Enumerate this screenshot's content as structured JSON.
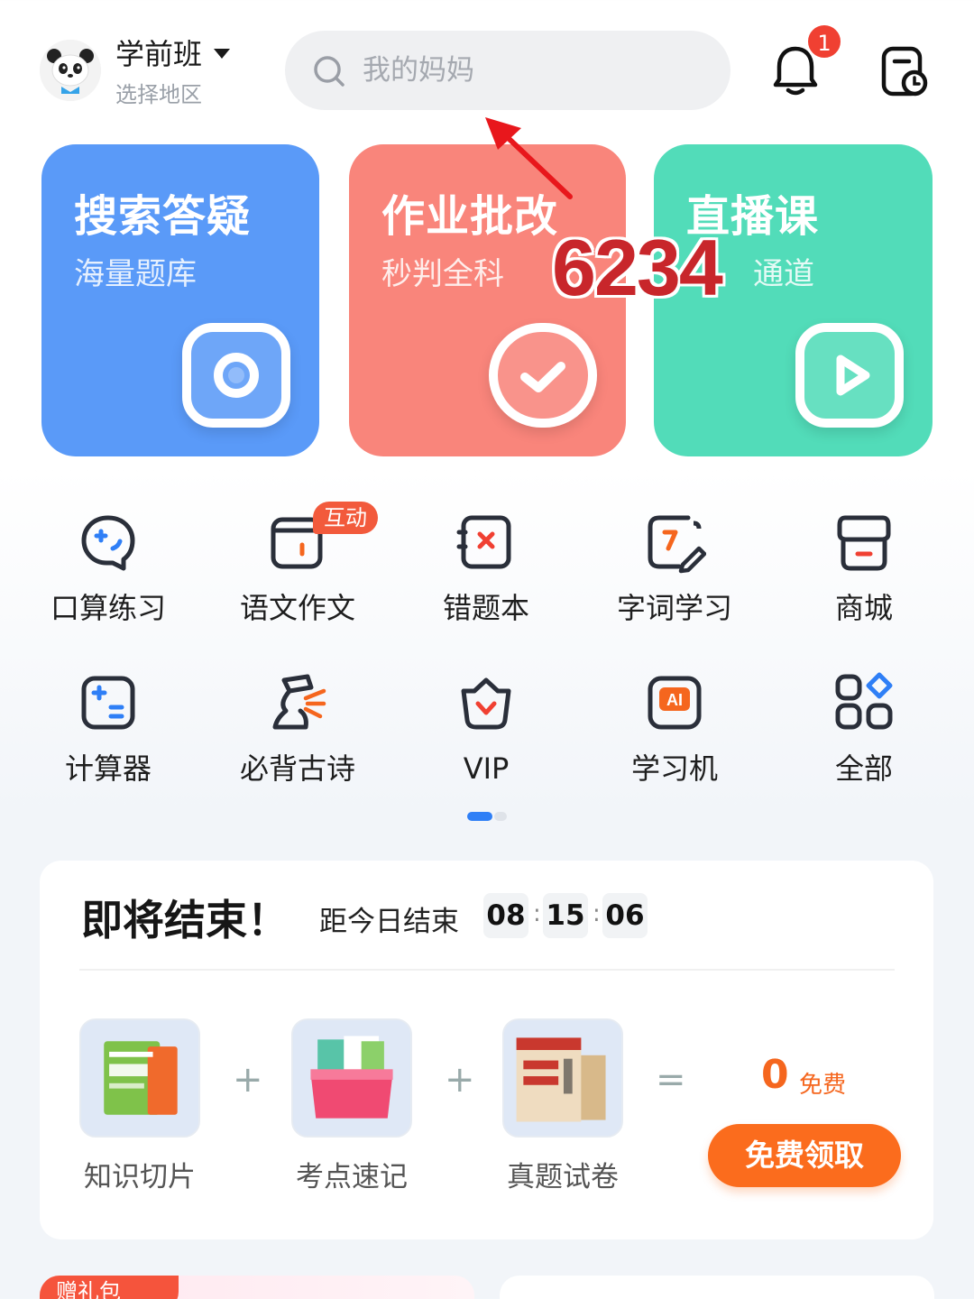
{
  "header": {
    "grade": "学前班",
    "region": "选择地区",
    "search_placeholder": "我的妈妈",
    "notification_count": "1"
  },
  "cards": [
    {
      "title": "搜索答疑",
      "subtitle": "海量题库",
      "icon": "camera-icon",
      "color": "#5a9af8"
    },
    {
      "title": "作业批改",
      "subtitle": "秒判全科",
      "icon": "check-icon",
      "color": "#f9857b"
    },
    {
      "title": "直播课",
      "subtitle": "通道",
      "icon": "play-icon",
      "color": "#52dcb9"
    }
  ],
  "overlay": {
    "number": "6234"
  },
  "grid": {
    "row1": [
      "口算练习",
      "语文作文",
      "错题本",
      "字词学习",
      "商城"
    ],
    "row2": [
      "计算器",
      "必背古诗",
      "VIP",
      "学习机",
      "全部"
    ],
    "tag": "互动"
  },
  "promo": {
    "title": "即将结束！",
    "countdown_label": "距今日结束",
    "hours": "08",
    "minutes": "15",
    "seconds": "06",
    "products": [
      "知识切片",
      "考点速记",
      "真题试卷"
    ],
    "plus": "+",
    "equals": "=",
    "price": "0",
    "price_note": "免费",
    "button": "免费领取"
  },
  "bottom": {
    "gift_tag": "赠礼包"
  },
  "colors": {
    "accent_blue": "#2f7ff6",
    "accent_orange": "#fb6c1d",
    "badge_red": "#f04032"
  }
}
